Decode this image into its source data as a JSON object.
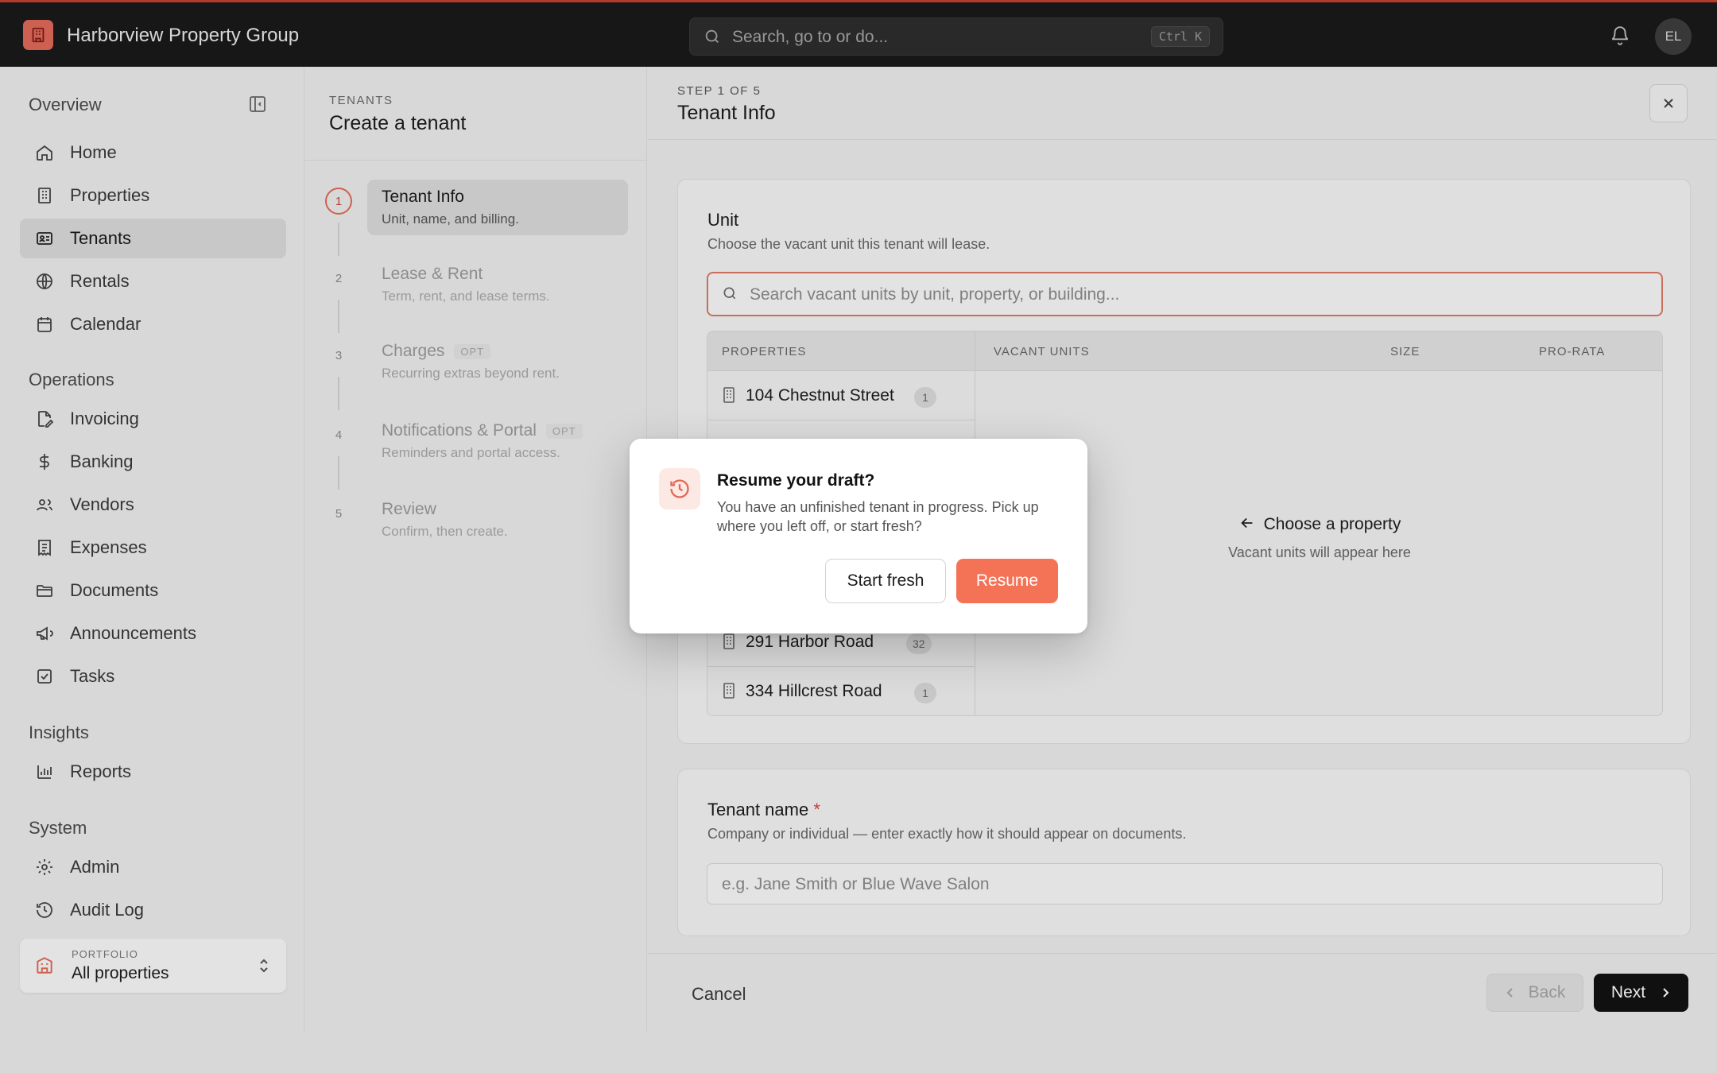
{
  "app": {
    "org_name": "Harborview Property Group",
    "accent": "#f47357"
  },
  "search": {
    "placeholder": "Search, go to or do...",
    "shortcut": "Ctrl K"
  },
  "user": {
    "initials": "EL"
  },
  "sidebar": {
    "groups": [
      {
        "label": "Overview",
        "items": [
          {
            "label": "Home",
            "icon": "home-icon"
          },
          {
            "label": "Properties",
            "icon": "building-icon"
          },
          {
            "label": "Tenants",
            "icon": "id-card-icon",
            "active": true
          },
          {
            "label": "Rentals",
            "icon": "globe-icon"
          },
          {
            "label": "Calendar",
            "icon": "calendar-icon"
          }
        ]
      },
      {
        "label": "Operations",
        "items": [
          {
            "label": "Invoicing",
            "icon": "file-edit-icon"
          },
          {
            "label": "Banking",
            "icon": "dollar-icon"
          },
          {
            "label": "Vendors",
            "icon": "users-icon"
          },
          {
            "label": "Expenses",
            "icon": "receipt-icon"
          },
          {
            "label": "Documents",
            "icon": "folder-icon"
          },
          {
            "label": "Announcements",
            "icon": "megaphone-icon"
          },
          {
            "label": "Tasks",
            "icon": "checkbox-icon"
          }
        ]
      },
      {
        "label": "Insights",
        "items": [
          {
            "label": "Reports",
            "icon": "bar-chart-icon"
          }
        ]
      },
      {
        "label": "System",
        "items": [
          {
            "label": "Admin",
            "icon": "gear-icon"
          },
          {
            "label": "Audit Log",
            "icon": "history-icon"
          }
        ]
      }
    ],
    "portfolio": {
      "label": "PORTFOLIO",
      "value": "All properties"
    }
  },
  "wizard": {
    "section_label": "TENANTS",
    "title": "Create a tenant",
    "steps": [
      {
        "num": "1",
        "title": "Tenant Info",
        "subtitle": "Unit, name, and billing.",
        "current": true
      },
      {
        "num": "2",
        "title": "Lease & Rent",
        "subtitle": "Term, rent, and lease terms."
      },
      {
        "num": "3",
        "title": "Charges",
        "subtitle": "Recurring extras beyond rent.",
        "badge": "OPT"
      },
      {
        "num": "4",
        "title": "Notifications & Portal",
        "subtitle": "Reminders and portal access.",
        "badge": "OPT"
      },
      {
        "num": "5",
        "title": "Review",
        "subtitle": "Confirm, then create."
      }
    ]
  },
  "main": {
    "step_label": "STEP 1 OF 5",
    "title": "Tenant Info",
    "unit_card": {
      "title": "Unit",
      "subtitle": "Choose the vacant unit this tenant will lease.",
      "search_placeholder": "Search vacant units by unit, property, or building...",
      "columns": {
        "properties": "PROPERTIES",
        "vacant_units": "VACANT UNITS",
        "size": "SIZE",
        "pro_rata": "PRO-RATA"
      },
      "properties": [
        {
          "name": "104 Chestnut Street",
          "count": "1"
        },
        {
          "name": "291 Harbor Road",
          "count": "32"
        },
        {
          "name": "334 Hillcrest Road",
          "count": "1"
        }
      ],
      "empty_title": "Choose a property",
      "empty_subtitle": "Vacant units will appear here"
    },
    "name_card": {
      "title": "Tenant name",
      "required_mark": "*",
      "subtitle": "Company or individual — enter exactly how it should appear on documents.",
      "placeholder": "e.g. Jane Smith or Blue Wave Salon"
    },
    "footer": {
      "cancel": "Cancel",
      "back": "Back",
      "next": "Next"
    }
  },
  "modal": {
    "title": "Resume your draft?",
    "body": "You have an unfinished tenant in progress. Pick up where you left off, or start fresh?",
    "secondary": "Start fresh",
    "primary": "Resume"
  }
}
